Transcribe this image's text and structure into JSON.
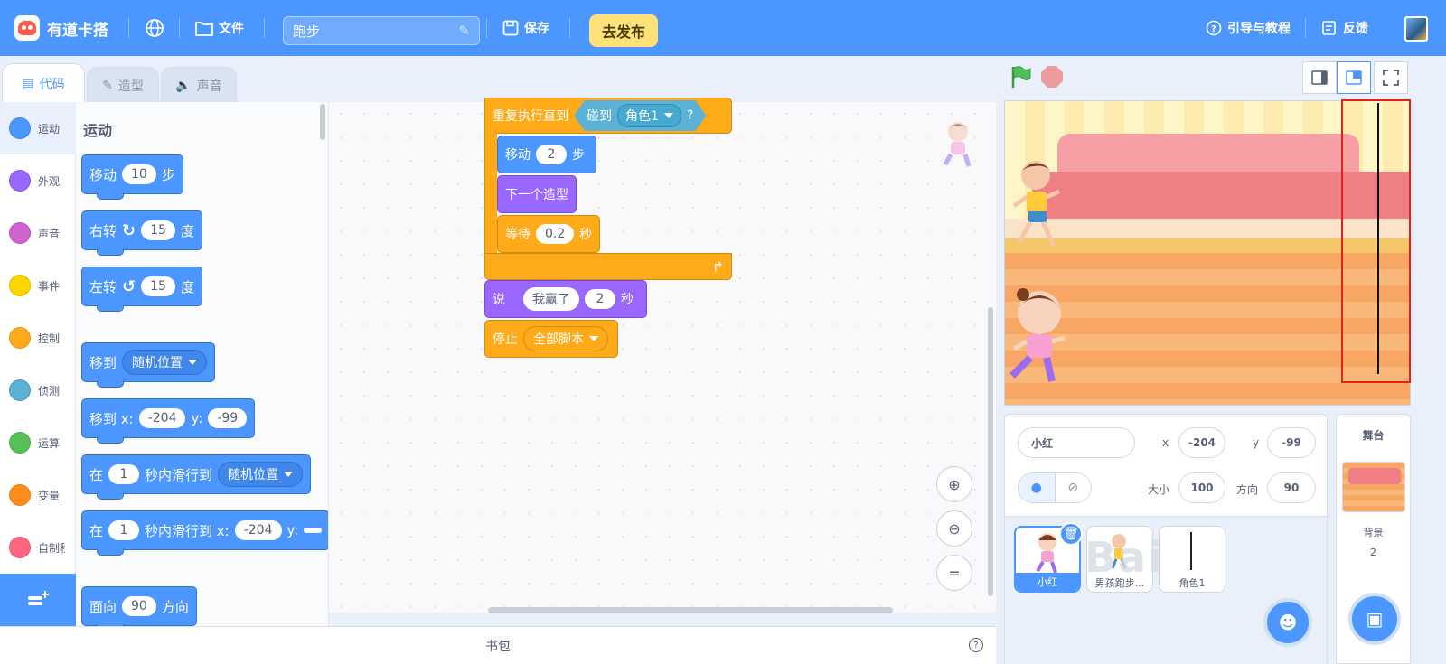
{
  "app": {
    "name": "有道卡搭",
    "file_menu": "文件",
    "project_title": "跑步",
    "save_label": "保存",
    "publish_label": "去发布",
    "guide_label": "引导与教程",
    "feedback_label": "反馈"
  },
  "tabs": [
    {
      "label": "代码",
      "icon": "code-icon"
    },
    {
      "label": "造型",
      "icon": "brush-icon"
    },
    {
      "label": "声音",
      "icon": "speaker-icon"
    }
  ],
  "categories": [
    {
      "label": "运动",
      "color": "#4c97ff"
    },
    {
      "label": "外观",
      "color": "#9966ff"
    },
    {
      "label": "声音",
      "color": "#cf63cf"
    },
    {
      "label": "事件",
      "color": "#ffd500"
    },
    {
      "label": "控制",
      "color": "#ffab19"
    },
    {
      "label": "侦测",
      "color": "#5cb1d6"
    },
    {
      "label": "运算",
      "color": "#59c059"
    },
    {
      "label": "变量",
      "color": "#ff8c1a"
    },
    {
      "label": "自制积木",
      "color": "#ff6680"
    }
  ],
  "palette": {
    "title": "运动",
    "move": {
      "a": "移动",
      "n": "10",
      "b": "步"
    },
    "turn_right": {
      "a": "右转",
      "n": "15",
      "b": "度"
    },
    "turn_left": {
      "a": "左转",
      "n": "15",
      "b": "度"
    },
    "goto": {
      "a": "移到",
      "opt": "随机位置"
    },
    "goto_xy": {
      "a": "移到 x:",
      "x": "-204",
      "yl": "y:",
      "y": "-99"
    },
    "glide": {
      "a": "在",
      "n": "1",
      "b": "秒内滑行到",
      "opt": "随机位置"
    },
    "glide_xy": {
      "a": "在",
      "n": "1",
      "b": "秒内滑行到 x:",
      "x": "-204",
      "yl": "y:"
    },
    "point": {
      "a": "面向",
      "n": "90",
      "b": "方向"
    }
  },
  "script": {
    "repeat_until": "重复执行直到",
    "touching": "碰到",
    "touching_target": "角色1",
    "q": "?",
    "move": {
      "a": "移动",
      "n": "2",
      "b": "步"
    },
    "next_costume": "下一个造型",
    "wait": {
      "a": "等待",
      "n": "0.2",
      "b": "秒"
    },
    "say": {
      "a": "说",
      "msg": "我赢了",
      "n": "2",
      "b": "秒"
    },
    "stop": {
      "a": "停止",
      "opt": "全部脚本"
    }
  },
  "zoom": {
    "in": "+",
    "out": "−",
    "reset": "="
  },
  "backpack": {
    "label": "书包",
    "help": "?"
  },
  "sprite_info": {
    "name": "小红",
    "x_label": "x",
    "x": "-204",
    "y_label": "y",
    "y": "-99",
    "size_label": "大小",
    "size": "100",
    "direction_label": "方向",
    "direction": "90"
  },
  "sprites": [
    {
      "name": "小红"
    },
    {
      "name": "男孩跑步..."
    },
    {
      "name": "角色1"
    }
  ],
  "stage_panel": {
    "title": "舞台",
    "backdrop_label": "背景",
    "backdrop_count": "2"
  },
  "watermark": "Bai",
  "colors": {
    "accent": "#4c97ff",
    "publish": "#ffe17a",
    "highlight": "#e2231a"
  }
}
